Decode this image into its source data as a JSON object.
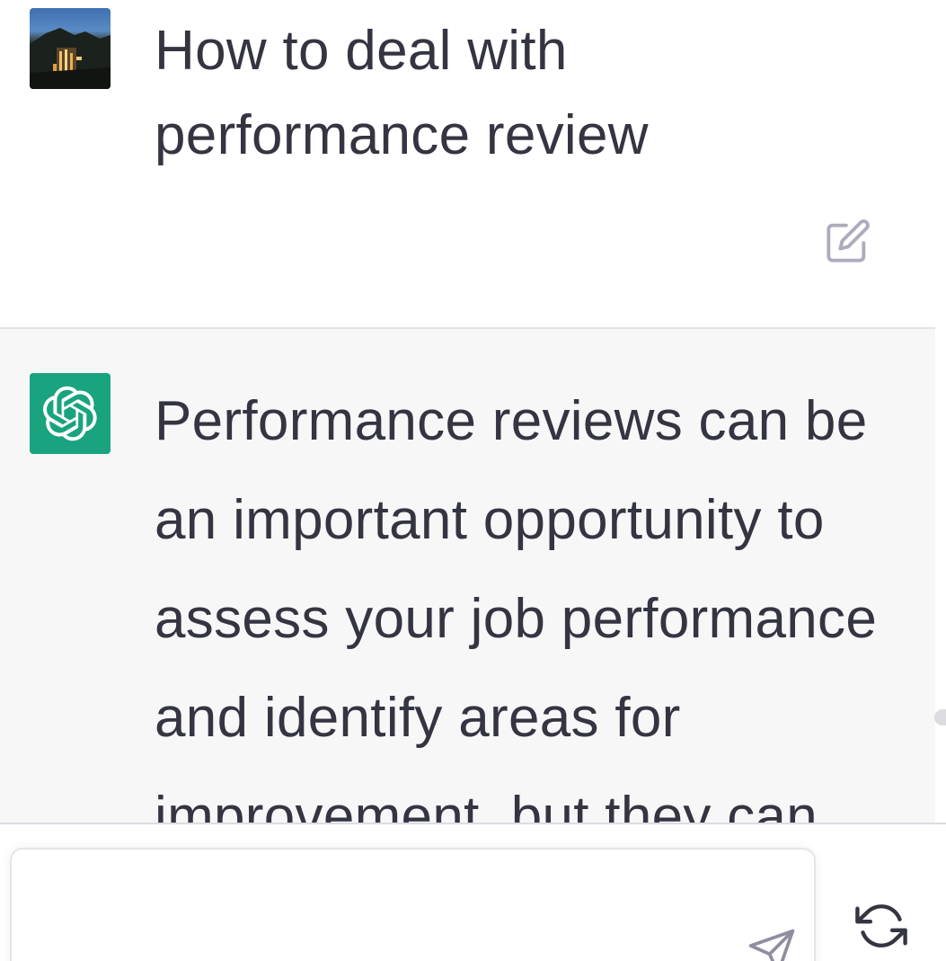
{
  "user_message": {
    "avatar": "user-photo-avatar",
    "text": "How to deal with performance review",
    "edit_icon": "edit-icon"
  },
  "assistant_message": {
    "avatar": "openai-logo-icon",
    "avatar_color": "#19a37f",
    "text": "Performance reviews can be an important opportunity to assess your job performance and identify areas for improvement, but they can"
  },
  "composer": {
    "input_value": "",
    "send_icon": "send-icon",
    "regenerate_icon": "regenerate-icon"
  },
  "colors": {
    "text": "#343541",
    "assistant_bg": "#f7f7f8",
    "icon_gray": "#acacbe"
  }
}
